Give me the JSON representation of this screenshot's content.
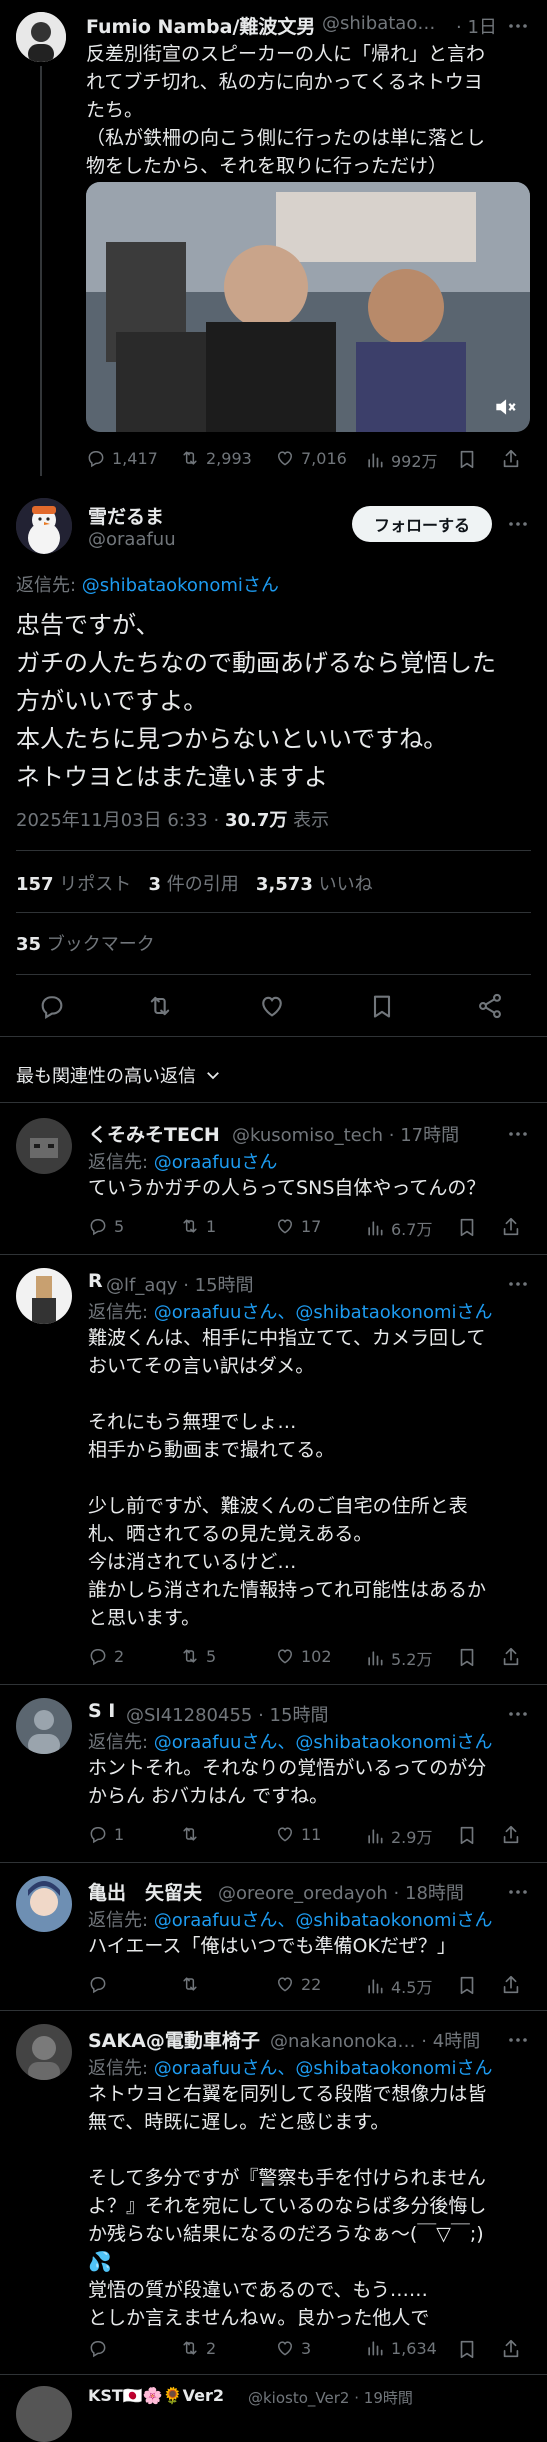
{
  "top_tweet": {
    "author": "Fumio Namba/難波文男",
    "handle": "@shibatao…",
    "time": "· 1日",
    "text": "反差別街宣のスピーカーの人に「帰れ」と言わ\nれてブチ切れ、私の方に向かってくるネトウヨ\nたち。\n（私が鉄柵の向こう側に行ったのは単に落とし\n物をしたから、それを取りに行っただけ）",
    "replies": "1,417",
    "retweets": "2,993",
    "likes": "7,016",
    "views": "992万"
  },
  "main_tweet": {
    "author": "雪だるま",
    "handle": "@oraafuu",
    "follow_label": "フォローする",
    "reply_to_prefix": "返信先: ",
    "reply_to_handle": "@shibataokonomiさん",
    "text": "忠告ですが、\nガチの人たちなので動画あげるなら覚悟した\n方がいいですよ。\n本人たちに見つからないといいですね。\nネトウヨとはまた違いますよ",
    "date": "2025年11月03日 6:33 · ",
    "views_count": "30.7万",
    "views_label": " 表示",
    "reposts_count": "157",
    "reposts_label": " リポスト",
    "quotes_count": "3",
    "quotes_label": " 件の引用",
    "likes_count": "3,573",
    "likes_label": " いいね",
    "bookmarks_count": "35",
    "bookmarks_label": " ブックマーク"
  },
  "sort_label": "最も関連性の高い返信",
  "replies": [
    {
      "author": "くそみそTECH",
      "handle": "@kusomiso_tech",
      "time": "· 17時間",
      "reply_prefix": "返信先: ",
      "reply_to": "@oraafuuさん",
      "text": "ていうかガチの人らってSNS自体やってんの？",
      "replies": "5",
      "retweets": "1",
      "likes": "17",
      "views": "6.7万"
    },
    {
      "author": "R",
      "handle": "@lf_aqy",
      "time": "· 15時間",
      "reply_prefix": "返信先: ",
      "reply_to": "@oraafuuさん、@shibataokonomiさん",
      "text": "難波くんは、相手に中指立てて、カメラ回して\nおいてその言い訳はダメ。\n\nそれにもう無理でしょ…\n相手から動画まで撮れてる。\n\n少し前ですが、難波くんのご自宅の住所と表\n札、晒されてるの見た覚えある。\n今は消されているけど…\n誰かしら消された情報持ってれ可能性はあるか\nと思います。",
      "replies": "2",
      "retweets": "5",
      "likes": "102",
      "views": "5.2万"
    },
    {
      "author": "S I",
      "handle": "@SI41280455",
      "time": "· 15時間",
      "reply_prefix": "返信先: ",
      "reply_to": "@oraafuuさん、@shibataokonomiさん",
      "text": "ホントそれ。それなりの覚悟がいるってのが分\nからん おバカはん ですね。",
      "replies": "1",
      "retweets": "",
      "likes": "11",
      "views": "2.9万"
    },
    {
      "author": "亀出　矢留夫",
      "handle": "@oreore_oredayoh",
      "time": "· 18時間",
      "reply_prefix": "返信先: ",
      "reply_to": "@oraafuuさん、@shibataokonomiさん",
      "text": "ハイエース「俺はいつでも準備OKだぜ？」",
      "replies": "",
      "retweets": "",
      "likes": "22",
      "views": "4.5万"
    },
    {
      "author": "SAKA@電動車椅子",
      "handle": "@nakanonoka…",
      "time": "· 4時間",
      "reply_prefix": "返信先: ",
      "reply_to": "@oraafuuさん、@shibataokonomiさん",
      "text": "ネトウヨと右翼を同列してる段階で想像力は皆\n無で、時既に遅し。だと感じます。\n\nそして多分ですが『警察も手を付けられません\nよ？』それを宛にしているのならば多分後悔し\nか残らない結果になるのだろうなぁ〜(￣▽￣;)\n💦\n覚悟の質が段違いであるので、もう……\nとしか言えませんねｗ。良かった他人で",
      "replies": "",
      "retweets": "2",
      "likes": "3",
      "views": "1,634"
    },
    {
      "author": "KST🇯🇵🌸🌻Ver2",
      "handle": "@kiosto_Ver2",
      "time": "· 19時間"
    }
  ]
}
